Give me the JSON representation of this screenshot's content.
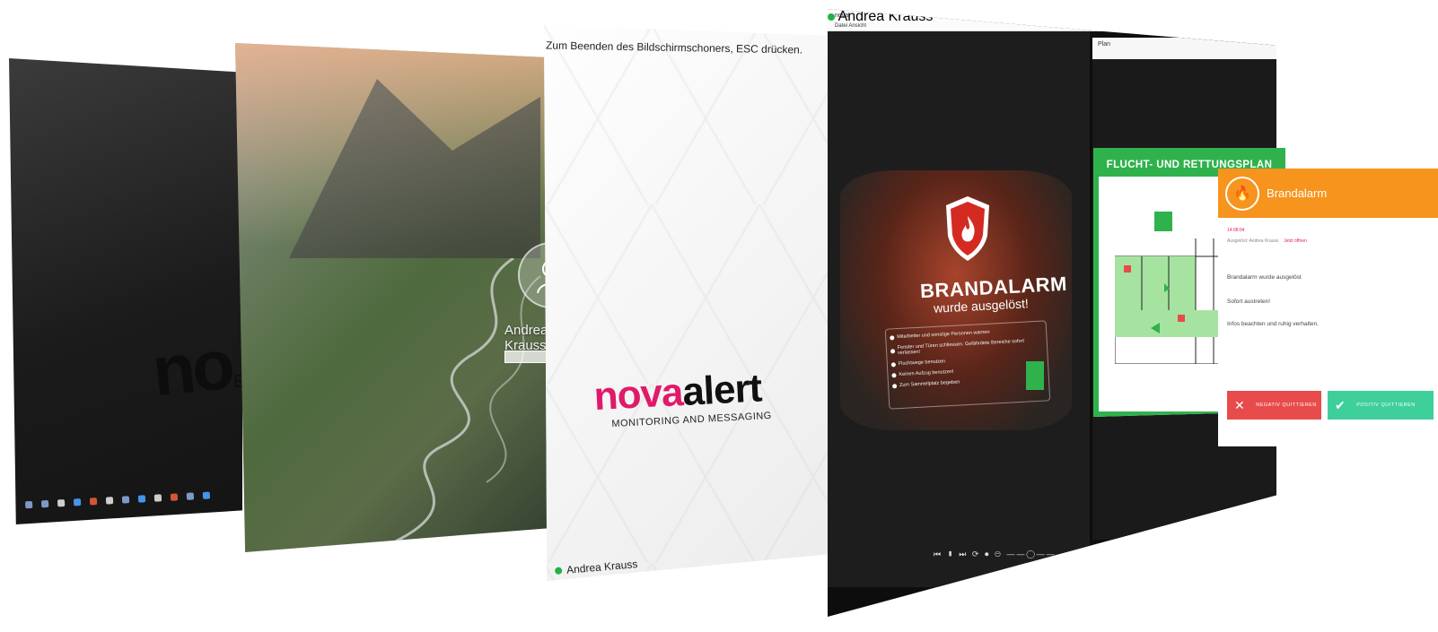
{
  "screensaver": {
    "hint": "Zum Beenden des Bildschirmschoners, ESC drücken.",
    "brand_primary": "nova",
    "brand_secondary": "alert",
    "brand_tagline": "MONITORING AND MESSAGING",
    "user": "Andrea Krauss"
  },
  "lock_screen": {
    "user": "Andrea Krauss"
  },
  "desktop": {
    "logo_text": "no",
    "logo_sub": "E"
  },
  "client": {
    "window_title": "nova",
    "menu": "Datei  Ansicht",
    "second_title": "Plan",
    "user": "Andrea Krauss",
    "alarm_title": "BRANDALARM",
    "alarm_subtitle": "wurde ausgelöst!",
    "instructions": [
      "Mitarbeiter und sonstige Personen warnen",
      "Fenster und Türen schliessen. Gefährdete Bereiche sofort verlassen!",
      "Fluchtwege benutzen",
      "Keinen Aufzug benutzen!",
      "Zum Sammelplatz begeben"
    ],
    "plan_title": "FLUCHT- UND RETTUNGSPLAN",
    "controls": "⏮ ▮ ⏭ ⟳ ⏺ ⊖ ——◯——"
  },
  "popup": {
    "title": "Brandalarm",
    "tag": "14:08:04",
    "sender_label": "Ausgelöst: Andrea Krauss",
    "link": "Jetzt öffnen",
    "line1": "Brandalarm wurde ausgelöst",
    "line2": "Sofort austreten!",
    "line3": "Infos beachten und ruhig verhalten.",
    "btn_negative": "NEGATIV QUITTIEREN",
    "btn_positive": "POSITIV QUITTIEREN"
  },
  "colors": {
    "brand_pink": "#e01a6a",
    "alarm_orange": "#f7941d",
    "exit_green": "#2fb24c",
    "negative_red": "#e84b4b",
    "positive_green": "#3fcf9b"
  }
}
